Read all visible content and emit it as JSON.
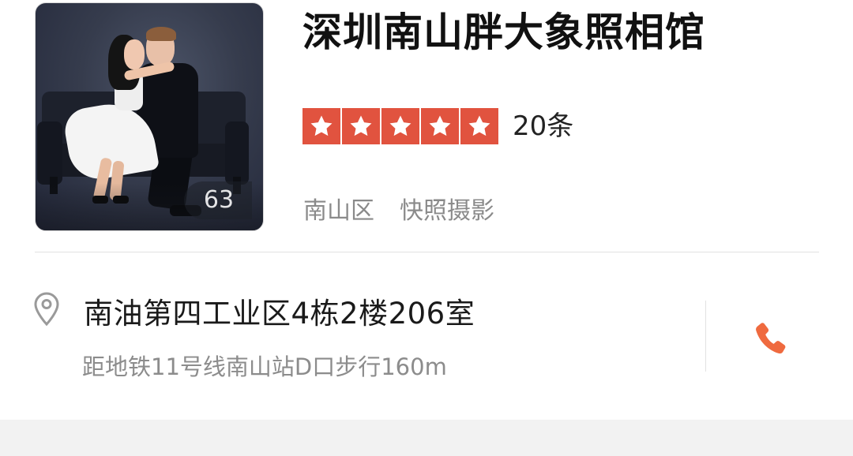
{
  "shop": {
    "name": "深圳南山胖大象照相馆",
    "photo_count": "63",
    "rating": {
      "stars": 5,
      "max_stars": 5,
      "review_count": "20条"
    },
    "tags": [
      "南山区",
      "快照摄影"
    ],
    "address": "南油第四工业区4栋2楼206室",
    "distance": "距地铁11号线南山站D口步行160m"
  },
  "icons": {
    "star": "star-icon",
    "location": "location-pin-icon",
    "phone": "phone-icon"
  },
  "colors": {
    "star_background": "#e1533f",
    "phone_accent": "#ef6a3f",
    "muted_text": "#8a8a8a"
  }
}
